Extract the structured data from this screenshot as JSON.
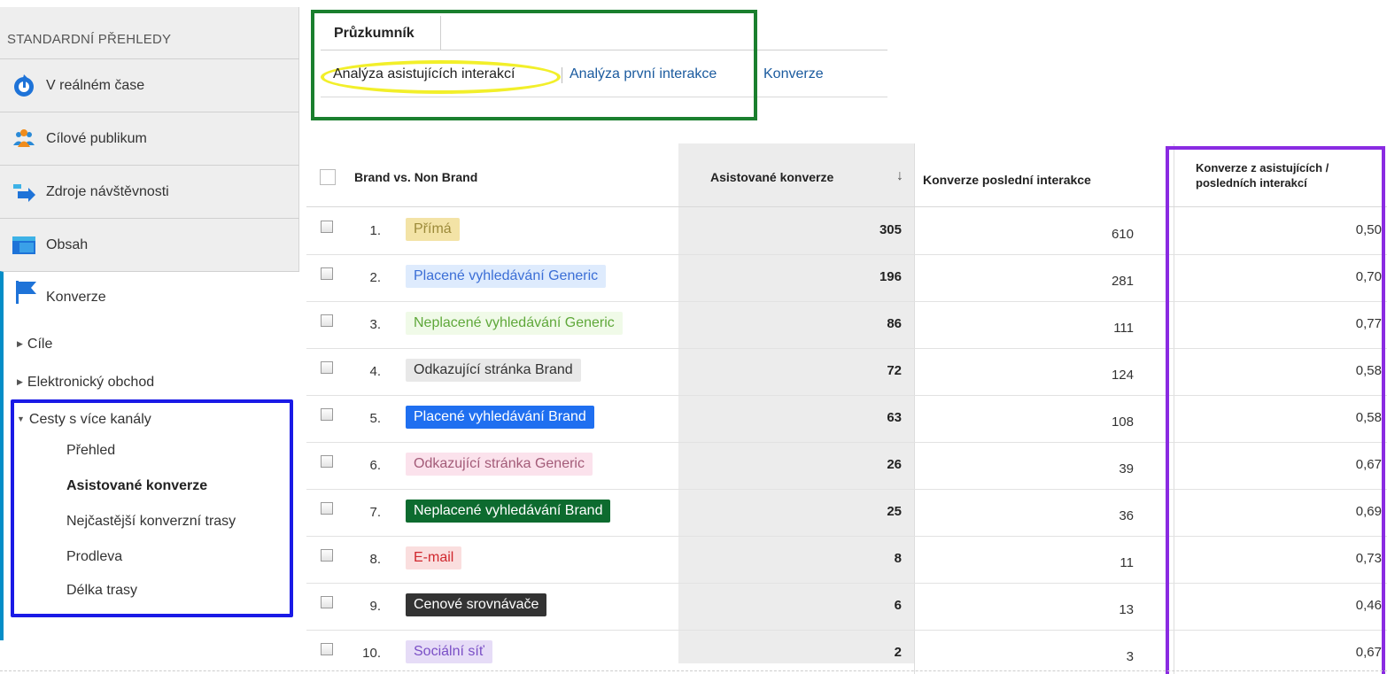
{
  "sidebar": {
    "heading": "STANDARDNÍ PŘEHLEDY",
    "items": [
      {
        "label": "V reálném čase",
        "icon": "realtime-icon"
      },
      {
        "label": "Cílové publikum",
        "icon": "audience-icon"
      },
      {
        "label": "Zdroje návštěvnosti",
        "icon": "traffic-sources-icon"
      },
      {
        "label": "Obsah",
        "icon": "content-icon"
      },
      {
        "label": "Konverze",
        "icon": "flag-icon"
      }
    ],
    "conversions_children": [
      "Cíle",
      "Elektronický obchod",
      "Cesty s více kanály"
    ],
    "multichannel_children": [
      "Přehled",
      "Asistované konverze",
      "Nejčastější konverzní trasy",
      "Prodleva",
      "Délka trasy"
    ]
  },
  "explorer": {
    "tab": "Průzkumník",
    "subtabs": [
      "Analýza asistujících interakcí",
      "Analýza první interakce",
      "Konverze"
    ]
  },
  "table": {
    "headers": {
      "dimension": "Brand vs. Non Brand",
      "assisted": "Asistované konverze",
      "last": "Konverze poslední interakce",
      "ratio_line1": "Konverze z asistujících /",
      "ratio_line2": "posledních interakcí"
    },
    "rows": [
      {
        "num": "1.",
        "label": "Přímá",
        "assisted": "305",
        "last": "610",
        "ratio": "0,50",
        "bg": "#f3e3a6",
        "fg": "#9c8a3a"
      },
      {
        "num": "2.",
        "label": "Placené vyhledávání Generic",
        "assisted": "196",
        "last": "281",
        "ratio": "0,70",
        "bg": "#deebfd",
        "fg": "#3b6ed6"
      },
      {
        "num": "3.",
        "label": "Neplacené vyhledávání Generic",
        "assisted": "86",
        "last": "111",
        "ratio": "0,77",
        "bg": "#f0fae8",
        "fg": "#5fa83a"
      },
      {
        "num": "4.",
        "label": "Odkazující stránka Brand",
        "assisted": "72",
        "last": "124",
        "ratio": "0,58",
        "bg": "#e8e8e8",
        "fg": "#333333"
      },
      {
        "num": "5.",
        "label": "Placené vyhledávání Brand",
        "assisted": "63",
        "last": "108",
        "ratio": "0,58",
        "bg": "#1f6ff0",
        "fg": "#ffffff"
      },
      {
        "num": "6.",
        "label": "Odkazující stránka Generic",
        "assisted": "26",
        "last": "39",
        "ratio": "0,67",
        "bg": "#fbe2ec",
        "fg": "#a35b78"
      },
      {
        "num": "7.",
        "label": "Neplacené vyhledávání Brand",
        "assisted": "25",
        "last": "36",
        "ratio": "0,69",
        "bg": "#0d6b2f",
        "fg": "#ffffff"
      },
      {
        "num": "8.",
        "label": "E-mail",
        "assisted": "8",
        "last": "11",
        "ratio": "0,73",
        "bg": "#fadede",
        "fg": "#d0282e"
      },
      {
        "num": "9.",
        "label": "Cenové srovnávače",
        "assisted": "6",
        "last": "13",
        "ratio": "0,46",
        "bg": "#333333",
        "fg": "#ffffff"
      },
      {
        "num": "10.",
        "label": "Sociální síť",
        "assisted": "2",
        "last": "3",
        "ratio": "0,67",
        "bg": "#e6dcf7",
        "fg": "#7a4fc6"
      }
    ]
  }
}
